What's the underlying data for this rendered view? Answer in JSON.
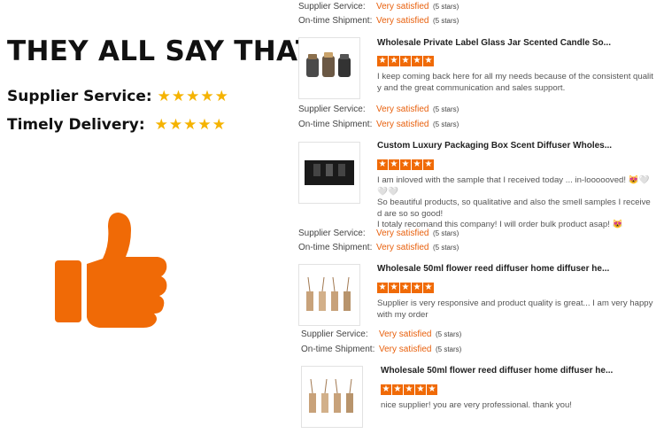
{
  "left": {
    "headline": "THEY ALL SAY THAT",
    "supplier_label": "Supplier Service:",
    "delivery_label": "Timely Delivery:",
    "stars": 5
  },
  "colors": {
    "accent": "#f06a06",
    "star_yellow": "#f5b301",
    "link_orange": "#e8600d"
  },
  "meta_labels": {
    "service": "Supplier Service:",
    "shipment": "On-time Shipment:"
  },
  "meta_value": "Very satisfied",
  "meta_stars": "(5 stars)",
  "top_meta": {
    "service_value": "Very satisfied",
    "shipment_value": "Very satisfied"
  },
  "reviews": [
    {
      "title": "Wholesale Private Label Glass Jar Scented Candle So...",
      "lines": [
        "I keep coming back here for all my needs because of the consistent qualit",
        "y and the great communication and sales support."
      ],
      "rating": 5
    },
    {
      "title": "Custom Luxury Packaging Box Scent Diffuser Wholes...",
      "lines": [
        "I am inloved with the sample that I received today ... in-loooooved! 😻🤍🤍🤍",
        "So beautiful products, so qualitative and also the smell samples I receive",
        "d are so so good!",
        "I totaly recomand this company! I will order bulk product asap! 😻"
      ],
      "rating": 5
    },
    {
      "title": "Wholesale 50ml flower reed diffuser home diffuser he...",
      "lines": [
        "Supplier is very responsive and product quality is great... I am very happy",
        "with my order"
      ],
      "rating": 5
    },
    {
      "title": "Wholesale 50ml flower reed diffuser home diffuser he...",
      "lines": [
        "nice supplier!    you are very professional.  thank you!"
      ],
      "rating": 5
    }
  ]
}
